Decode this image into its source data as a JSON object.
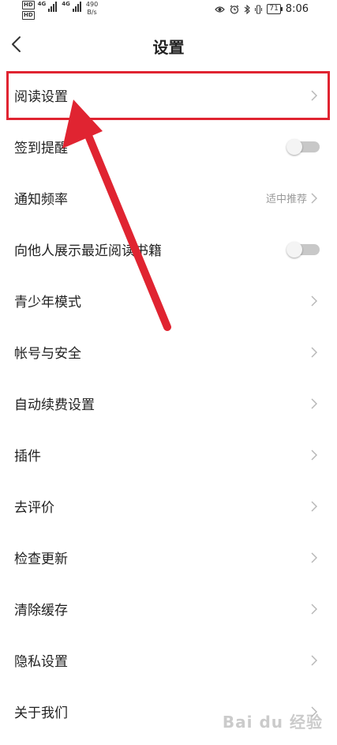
{
  "status_bar": {
    "hd_top": "HD",
    "hd_bottom": "HD",
    "sig1_label": "4G",
    "sig2_label": "4G",
    "net_speed_value": "490",
    "net_speed_unit": "B/s",
    "battery": "71",
    "time": "8:06"
  },
  "header": {
    "title": "设置"
  },
  "menu": {
    "items": [
      {
        "label": "阅读设置"
      },
      {
        "label": "签到提醒"
      },
      {
        "label": "通知频率",
        "value": "适中推荐"
      },
      {
        "label": "向他人展示最近阅读书籍"
      },
      {
        "label": "青少年模式"
      },
      {
        "label": "帐号与安全"
      },
      {
        "label": "自动续费设置"
      },
      {
        "label": "插件"
      },
      {
        "label": "去评价"
      },
      {
        "label": "检查更新"
      },
      {
        "label": "清除缓存"
      },
      {
        "label": "隐私设置"
      },
      {
        "label": "关于我们"
      }
    ]
  },
  "toggles": {
    "sign_in_reminder": false,
    "show_recent_books": false
  },
  "colors": {
    "annotation_red": "#e02431",
    "value_gray": "#999999"
  },
  "watermark": "Bai du 经验"
}
